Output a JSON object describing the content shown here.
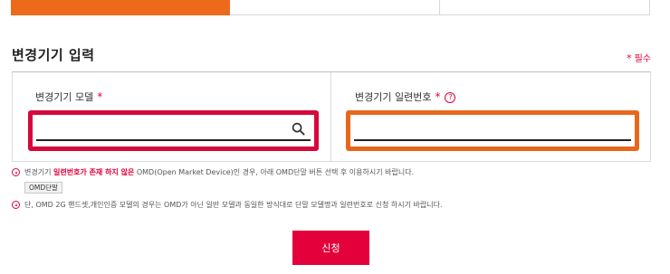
{
  "tabs": [
    {
      "label": "",
      "active": true
    },
    {
      "label": "",
      "active": false
    },
    {
      "label": "",
      "active": false
    }
  ],
  "section": {
    "title": "변경기기 입력",
    "required_legend": "필수",
    "required_star": "*"
  },
  "fields": {
    "model": {
      "label": "변경기기 모델",
      "required_mark": "*",
      "value": "",
      "icon": "search-icon"
    },
    "serial": {
      "label": "변경기기 일련번호",
      "required_mark": "*",
      "help": "?",
      "value": ""
    }
  },
  "notes": {
    "note1_pre": "변경기기 ",
    "note1_highlight": "일련번호가 존재 하지 않은",
    "note1_post": " OMD(Open Market Device)인 경우, 아래 OMD단말 버튼 선택 후 이용하시기 바랍니다.",
    "omd_button": "OMD단말",
    "note2": "단, OMD 2G 핸드셋,개인인증 모델의 경우는 OMD가 아닌 일반 모델과 동일한 방식대로 단말 모델명과 일련번호로 신청 하시기 바랍니다."
  },
  "submit_label": "신청",
  "colors": {
    "accent_orange": "#ee6a1b",
    "accent_red": "#e4003a",
    "model_frame": "#d6083b",
    "serial_frame": "#e8681b"
  }
}
